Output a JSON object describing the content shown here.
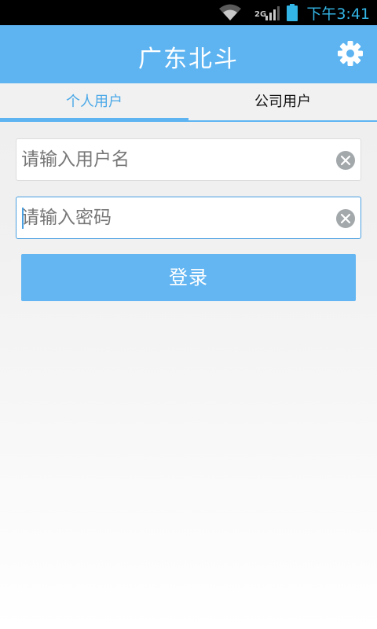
{
  "status_bar": {
    "network": "2G",
    "time": "下午3:41",
    "icons": [
      "wifi-icon",
      "signal-icon",
      "battery-icon"
    ]
  },
  "header": {
    "title": "广东北斗",
    "settings_icon": "gear-icon"
  },
  "tabs": [
    {
      "label": "个人用户",
      "active": true
    },
    {
      "label": "公司用户",
      "active": false
    }
  ],
  "form": {
    "username": {
      "value": "",
      "placeholder": "请输入用户名",
      "clear_icon": "clear-icon"
    },
    "password": {
      "value": "",
      "placeholder": "请输入密码",
      "clear_icon": "clear-icon",
      "focused": true
    },
    "login_label": "登录"
  },
  "colors": {
    "accent": "#5db4f1",
    "active_tab_text": "#4aa8e8",
    "clock": "#33b5e5",
    "clear_icon": "#a3a8ab"
  }
}
